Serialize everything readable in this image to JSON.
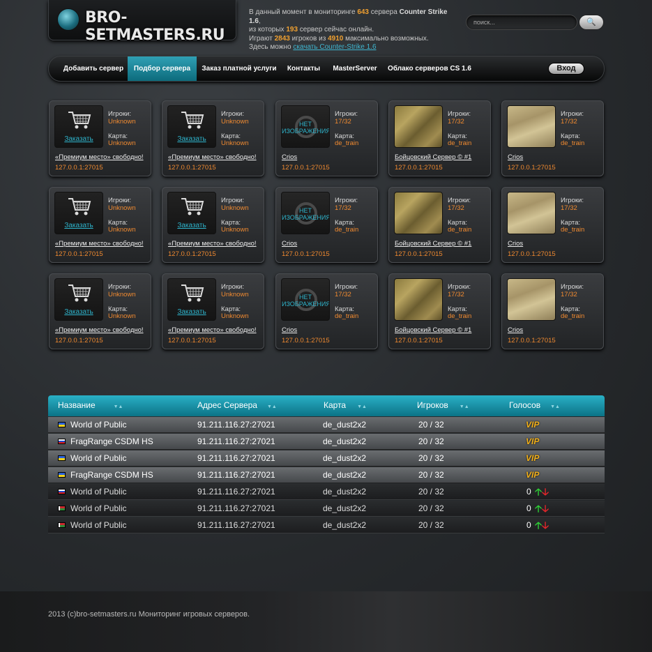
{
  "header": {
    "logo_text": "BRO-SETMASTERS.RU",
    "stats": {
      "l1_pre": "В данный момент в мониторинге ",
      "servers_total": "643",
      "l1_mid": " сервера ",
      "game": "Counter Strike 1.6",
      "l1_end": ",",
      "l2_pre": "из которых ",
      "servers_online": "193",
      "l2_end": " сервер сейчас онлайн.",
      "l3_pre": "Играют ",
      "players": "2843",
      "l3_mid": " игроков из ",
      "players_max": "4910",
      "l3_end": " максимально возможных.",
      "l4_pre": "Здесь можно ",
      "download_link": "скачать Counter-Strike 1.6"
    },
    "search_placeholder": "поиск...",
    "search_button_icon": "magnifier-icon"
  },
  "nav": {
    "items": [
      "Добавить сервер",
      "Подбор сервера",
      "Заказ платной услуги",
      "Контакты",
      "MasterServer",
      "Облако серверов CS 1.6"
    ],
    "active_index": 1,
    "login": "Вход"
  },
  "cards_common": {
    "players_label": "Игроки:",
    "map_label": "Карта:",
    "order_label": "Заказать",
    "noimage_label": "НЕТ ИЗОБРАЖЕНИЯ"
  },
  "cards": [
    {
      "kind": "buy",
      "players": "Unknown",
      "map": "Unknown",
      "name": "«Премиум место» свободно!",
      "ip": "127.0.0.1:27015"
    },
    {
      "kind": "buy",
      "players": "Unknown",
      "map": "Unknown",
      "name": "«Премиум место» свободно!",
      "ip": "127.0.0.1:27015"
    },
    {
      "kind": "noimg",
      "players": "17/32",
      "map": "de_train",
      "name": "Crios",
      "ip": "127.0.0.1:27015"
    },
    {
      "kind": "map1",
      "players": "17/32",
      "map": "de_train",
      "name": "Бойцовский Сервер © #1",
      "ip": "127.0.0.1:27015"
    },
    {
      "kind": "map2",
      "players": "17/32",
      "map": "de_train",
      "name": "Crios",
      "ip": "127.0.0.1:27015"
    }
  ],
  "table": {
    "headers": [
      "Название",
      "Адрес Сервера",
      "Карта",
      "Игроков",
      "Голосов"
    ],
    "vip_label": "VIP",
    "rows": [
      {
        "flag": "ua",
        "name": "World of Public",
        "address": "91.211.116.27:27021",
        "map": "de_dust2x2",
        "players": "20 / 32",
        "vip": true
      },
      {
        "flag": "ru",
        "name": "FragRange CSDM HS",
        "address": "91.211.116.27:27021",
        "map": "de_dust2x2",
        "players": "20 / 32",
        "vip": true
      },
      {
        "flag": "ua",
        "name": "World of Public",
        "address": "91.211.116.27:27021",
        "map": "de_dust2x2",
        "players": "20 / 32",
        "vip": true
      },
      {
        "flag": "ua",
        "name": "FragRange CSDM HS",
        "address": "91.211.116.27:27021",
        "map": "de_dust2x2",
        "players": "20 / 32",
        "vip": true
      },
      {
        "flag": "ru",
        "name": "World of Public",
        "address": "91.211.116.27:27021",
        "map": "de_dust2x2",
        "players": "20 / 32",
        "vip": false,
        "votes": "0"
      },
      {
        "flag": "by",
        "name": "World of Public",
        "address": "91.211.116.27:27021",
        "map": "de_dust2x2",
        "players": "20 / 32",
        "vip": false,
        "votes": "0"
      },
      {
        "flag": "by",
        "name": "World of Public",
        "address": "91.211.116.27:27021",
        "map": "de_dust2x2",
        "players": "20 / 32",
        "vip": false,
        "votes": "0"
      }
    ]
  },
  "footer": {
    "copyright": "2013 (c)bro-setmasters.ru Мониторинг игровых серверов."
  }
}
